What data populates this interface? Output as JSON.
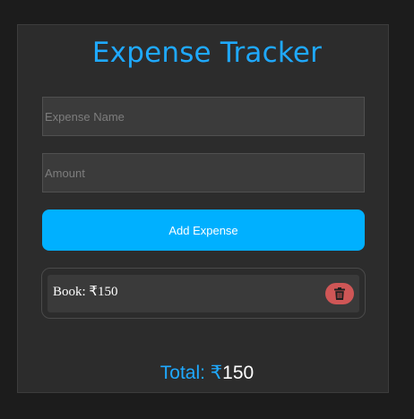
{
  "app": {
    "title": "Expense Tracker"
  },
  "form": {
    "name_placeholder": "Expense Name",
    "amount_placeholder": "Amount",
    "add_label": "Add Expense"
  },
  "expenses": [
    {
      "text": "Book: ₹150",
      "delete_icon": "trash-icon"
    }
  ],
  "summary": {
    "total_label": "Total: ₹",
    "total_value": "150"
  },
  "colors": {
    "accent": "#1fa9ff",
    "button": "#00b0ff",
    "delete": "#cf5656"
  }
}
